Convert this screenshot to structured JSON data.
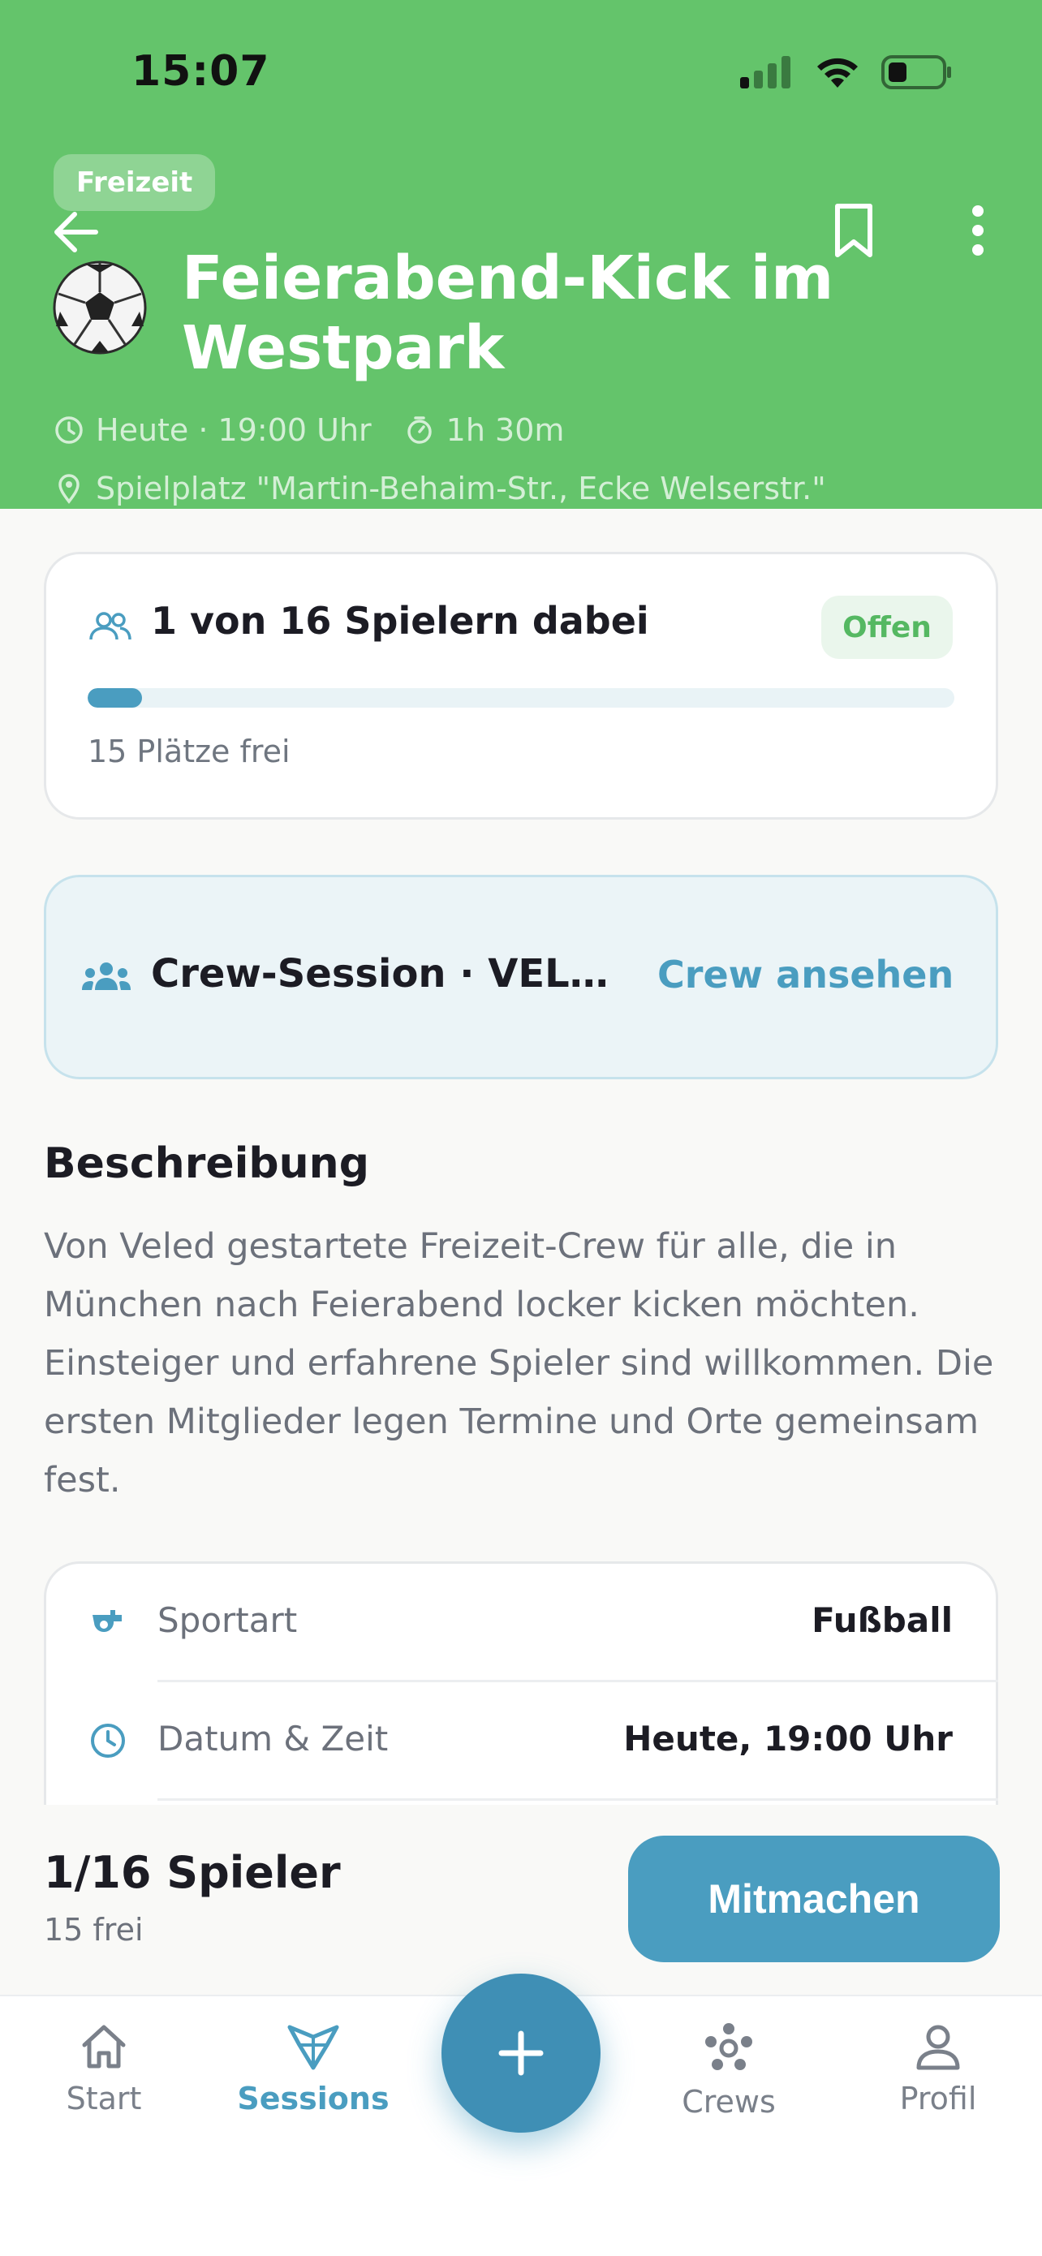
{
  "status_bar": {
    "time": "15:07"
  },
  "header": {
    "category": "Freizeit",
    "title": "Feierabend-Kick im Westpark",
    "when": "Heute · 19:00 Uhr",
    "duration": "1h 30m",
    "location": "Spielplatz \"Martin-Behaim-Str., Ecke Welserstr.\"",
    "icons": [
      "back-arrow-icon",
      "bookmark-icon",
      "more-vertical-icon",
      "soccer-ball-icon",
      "clock-icon",
      "timer-icon",
      "location-pin-icon"
    ]
  },
  "players_card": {
    "title": "1 von 16 Spielern dabei",
    "status": "Offen",
    "free_text": "15 Plätze frei",
    "progress": {
      "current": 1,
      "total": 16
    }
  },
  "crew_card": {
    "label": "Crew-Session · VELED Munich Kickers",
    "link": "Crew ansehen"
  },
  "description": {
    "heading": "Beschreibung",
    "text": "Von Veled gestartete Freizeit-Crew für alle, die in München nach Feierabend locker kicken möchten. Einsteiger und erfahrene Spieler sind willkommen. Die ersten Mitglieder legen Termine und Orte gemeinsam fest."
  },
  "details": [
    {
      "label": "Sportart",
      "value": "Fußball"
    },
    {
      "label": "Datum & Zeit",
      "value": "Heute, 19:00 Uhr"
    }
  ],
  "action_bar": {
    "count": "1/16 Spieler",
    "free": "15 frei",
    "button": "Mitmachen"
  },
  "tabs": [
    {
      "label": "Start",
      "active": false
    },
    {
      "label": "Sessions",
      "active": true
    },
    {
      "label": "Crews",
      "active": false
    },
    {
      "label": "Profil",
      "active": false
    }
  ],
  "colors": {
    "header_green": "#64c46b",
    "accent_blue": "#4a9dc0",
    "open_green": "#55b862"
  }
}
